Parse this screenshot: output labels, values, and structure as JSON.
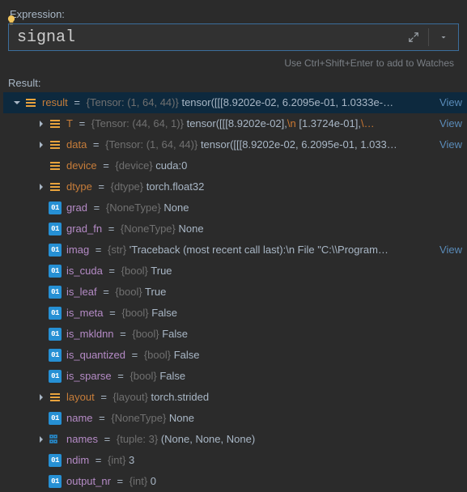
{
  "labels": {
    "expression": "Expression:",
    "result": "Result:",
    "hint": "Use Ctrl+Shift+Enter to add to Watches",
    "view": "View"
  },
  "expression": {
    "value": "signal"
  },
  "tree": {
    "root": {
      "name": "result",
      "type": "{Tensor: (1, 64, 44)}",
      "value": "tensor([[[8.9202e-02, 6.2095e-01, 1.0333e-…",
      "hasView": true
    },
    "children": [
      {
        "kind": "obj",
        "expandable": true,
        "purple": false,
        "name": "T",
        "type": "{Tensor: (44, 64, 1)}",
        "value_parts": [
          "tensor([[[8.9202e-02],",
          "\\n",
          "        [1.3724e-01],",
          "\\…"
        ],
        "hasView": true
      },
      {
        "kind": "obj",
        "expandable": true,
        "purple": false,
        "name": "data",
        "type": "{Tensor: (1, 64, 44)}",
        "value": "tensor([[[8.9202e-02, 6.2095e-01, 1.033…",
        "hasView": true
      },
      {
        "kind": "obj",
        "expandable": false,
        "purple": false,
        "name": "device",
        "type": "{device}",
        "value": "cuda:0"
      },
      {
        "kind": "obj",
        "expandable": true,
        "purple": false,
        "name": "dtype",
        "type": "{dtype}",
        "value": "torch.float32"
      },
      {
        "kind": "prim",
        "expandable": false,
        "purple": true,
        "name": "grad",
        "type": "{NoneType}",
        "value": "None"
      },
      {
        "kind": "prim",
        "expandable": false,
        "purple": true,
        "name": "grad_fn",
        "type": "{NoneType}",
        "value": "None"
      },
      {
        "kind": "prim",
        "expandable": false,
        "purple": true,
        "name": "imag",
        "type": "{str}",
        "value": "'Traceback (most recent call last):\\n  File \"C:\\\\Program…",
        "hasView": true
      },
      {
        "kind": "prim",
        "expandable": false,
        "purple": true,
        "name": "is_cuda",
        "type": "{bool}",
        "value": "True"
      },
      {
        "kind": "prim",
        "expandable": false,
        "purple": true,
        "name": "is_leaf",
        "type": "{bool}",
        "value": "True"
      },
      {
        "kind": "prim",
        "expandable": false,
        "purple": true,
        "name": "is_meta",
        "type": "{bool}",
        "value": "False"
      },
      {
        "kind": "prim",
        "expandable": false,
        "purple": true,
        "name": "is_mkldnn",
        "type": "{bool}",
        "value": "False"
      },
      {
        "kind": "prim",
        "expandable": false,
        "purple": true,
        "name": "is_quantized",
        "type": "{bool}",
        "value": "False"
      },
      {
        "kind": "prim",
        "expandable": false,
        "purple": true,
        "name": "is_sparse",
        "type": "{bool}",
        "value": "False"
      },
      {
        "kind": "obj",
        "expandable": true,
        "purple": false,
        "name": "layout",
        "type": "{layout}",
        "value": "torch.strided"
      },
      {
        "kind": "prim",
        "expandable": false,
        "purple": true,
        "name": "name",
        "type": "{NoneType}",
        "value": "None"
      },
      {
        "kind": "tuple",
        "expandable": true,
        "purple": true,
        "name": "names",
        "type": "{tuple: 3}",
        "value": "(None, None, None)"
      },
      {
        "kind": "prim",
        "expandable": false,
        "purple": true,
        "name": "ndim",
        "type": "{int}",
        "value": "3"
      },
      {
        "kind": "prim",
        "expandable": false,
        "purple": true,
        "name": "output_nr",
        "type": "{int}",
        "value": "0"
      }
    ]
  }
}
